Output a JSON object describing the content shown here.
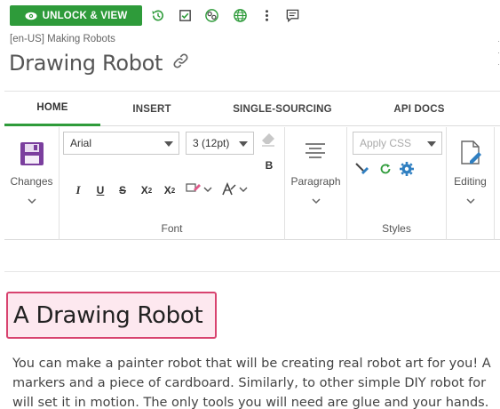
{
  "toolbar": {
    "unlock_label": "UNLOCK & VIEW",
    "icons": [
      "history-icon",
      "checkbox-icon",
      "settings-group-icon",
      "globe-icon",
      "more-vertical-icon",
      "comment-icon"
    ]
  },
  "breadcrumb": "[en-US] Making Robots",
  "page_title": "Drawing Robot",
  "tabs": [
    {
      "label": "HOME",
      "active": true
    },
    {
      "label": "INSERT",
      "active": false
    },
    {
      "label": "SINGLE-SOURCING",
      "active": false
    },
    {
      "label": "API DOCS",
      "active": false
    }
  ],
  "ribbon": {
    "changes_label": "Changes",
    "font": {
      "family_value": "Arial",
      "size_value": "3 (12pt)",
      "bold": "B",
      "italic": "I",
      "underline": "U",
      "strike": "S",
      "subscript": "X",
      "subscript_mark": "2",
      "superscript": "X",
      "superscript_mark": "2",
      "group_label": "Font"
    },
    "paragraph_label": "Paragraph",
    "styles": {
      "css_placeholder": "Apply CSS",
      "group_label": "Styles"
    },
    "editing_label": "Editing"
  },
  "editor": {
    "heading": "A Drawing Robot",
    "paragraph_lines": [
      "You can make a painter robot that will be creating real robot art for you! A",
      "markers and a piece of cardboard. Similarly, to other simple DIY robot for",
      "will set it in motion. The only tools you will need are glue and your hands."
    ]
  },
  "colors": {
    "accent_green": "#2e9b3a",
    "heading_border": "#d8436f",
    "heading_bg": "#fde8ef",
    "save_icon": "#7b3f9e",
    "styles_icon": "#2f7fc1"
  }
}
